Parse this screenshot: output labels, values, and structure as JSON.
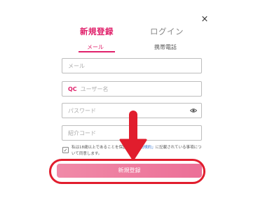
{
  "dialog": {
    "close_label": "×",
    "tabs": {
      "register": "新規登録",
      "login": "ログイン"
    },
    "subtabs": {
      "mail": "メール",
      "phone": "携帯電話"
    },
    "fields": {
      "email_placeholder": "メール",
      "username_prefix": "QC",
      "username_placeholder": "ユーザー名",
      "password_placeholder": "パスワード",
      "referral_placeholder": "紹介コード"
    },
    "agreement": {
      "check_mark": "✓",
      "text_before": "私は18歳以上であることを保証し、",
      "link_text": "「利用規約」",
      "text_after": "に記載されている事項について同意します。"
    },
    "submit_label": "新規登録"
  },
  "colors": {
    "accent": "#e0216b",
    "highlight": "#e11d2d",
    "button": "#ec6f97"
  },
  "icons": {
    "close": "close-icon",
    "eye": "eye-icon",
    "check": "check-icon",
    "arrow": "down-arrow-icon"
  }
}
